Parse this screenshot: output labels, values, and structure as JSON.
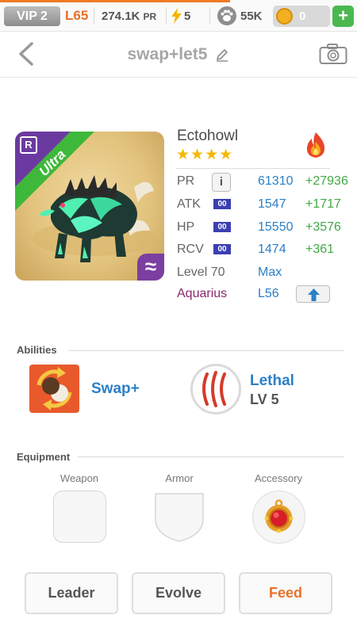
{
  "topbar": {
    "vip": "VIP 2",
    "level": "L65",
    "power": "274.1K",
    "power_unit": "PR",
    "energy": "5",
    "food": "55K",
    "coins": "0",
    "add_label": "+"
  },
  "header": {
    "title": "swap+let5"
  },
  "monster": {
    "name": "Ectohowl",
    "stars": "★★★★",
    "rarity": "Ultra",
    "rank_badge": "R",
    "element_badge": "≈",
    "element": "fire",
    "stats": [
      {
        "label": "PR",
        "value": "61310",
        "bonus": "+27936"
      },
      {
        "label": "ATK",
        "value": "1547",
        "bonus": "+1717"
      },
      {
        "label": "HP",
        "value": "15550",
        "bonus": "+3576"
      },
      {
        "label": "RCV",
        "value": "1474",
        "bonus": "+361"
      }
    ],
    "info_label": "i",
    "rune_label": "00",
    "level_label": "Level 70",
    "level_value": "Max",
    "sign": "Aquarius",
    "sign_level": "L56"
  },
  "abilities": {
    "section_title": "Abilities",
    "items": [
      {
        "name": "Swap+",
        "icon": "swap-arrows-icon"
      },
      {
        "name": "Lethal",
        "level": "LV 5",
        "icon": "claw-marks-icon"
      }
    ]
  },
  "equipment": {
    "section_title": "Equipment",
    "slots": [
      {
        "label": "Weapon",
        "icon": ""
      },
      {
        "label": "Armor",
        "icon": ""
      },
      {
        "label": "Accessory",
        "icon": "ruby-amulet-icon"
      }
    ]
  },
  "actions": {
    "leader": "Leader",
    "evolve": "Evolve",
    "feed": "Feed"
  },
  "colors": {
    "accent_orange": "#e8702a",
    "stat_blue": "#2b7fc7",
    "bonus_green": "#41a846",
    "rarity_green": "#3db83a",
    "rank_purple": "#7a3fa0",
    "sign_purple": "#8a2a6e"
  }
}
